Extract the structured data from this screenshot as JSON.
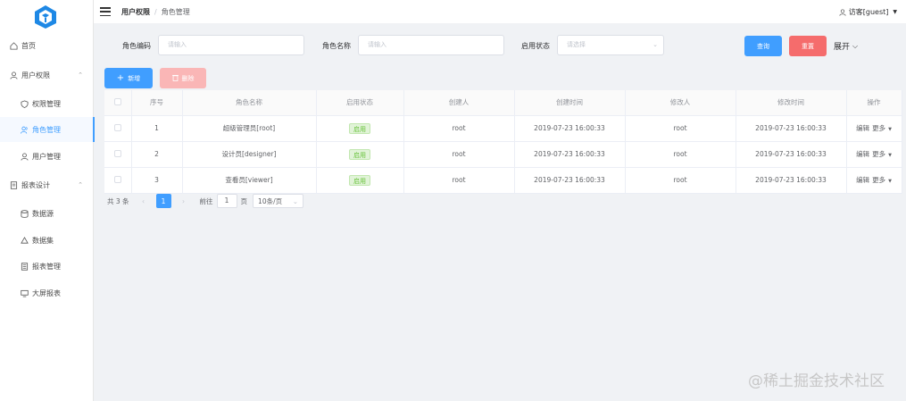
{
  "sidebar": {
    "home": "首页",
    "user_perm": "用户权限",
    "perm_mgmt": "权限管理",
    "role_mgmt": "角色管理",
    "user_mgmt": "用户管理",
    "report_design": "报表设计",
    "datasource": "数据源",
    "dataset": "数据集",
    "report_mgmt": "报表管理",
    "screen_report": "大屏报表"
  },
  "header": {
    "breadcrumb_1": "用户权限",
    "breadcrumb_sep": "/",
    "breadcrumb_2": "角色管理",
    "user": "访客[guest]"
  },
  "search": {
    "role_code_label": "角色编码",
    "role_code_placeholder": "请输入",
    "role_name_label": "角色名称",
    "role_name_placeholder": "请输入",
    "enabled_label": "启用状态",
    "enabled_placeholder": "请选择",
    "query": "查询",
    "reset": "重置",
    "expand": "展开"
  },
  "toolbar": {
    "add": "新增",
    "delete": "删除"
  },
  "table": {
    "headers": [
      "序号",
      "角色名称",
      "启用状态",
      "创建人",
      "创建时间",
      "修改人",
      "修改时间",
      "操作"
    ],
    "rows": [
      {
        "index": "1",
        "name": "超级管理员[root]",
        "status": "启用",
        "creator": "root",
        "created": "2019-07-23 16:00:33",
        "modifier": "root",
        "modified": "2019-07-23 16:00:33",
        "edit": "编辑",
        "more": "更多"
      },
      {
        "index": "2",
        "name": "设计员[designer]",
        "status": "启用",
        "creator": "root",
        "created": "2019-07-23 16:00:33",
        "modifier": "root",
        "modified": "2019-07-23 16:00:33",
        "edit": "编辑",
        "more": "更多"
      },
      {
        "index": "3",
        "name": "查看员[viewer]",
        "status": "启用",
        "creator": "root",
        "created": "2019-07-23 16:00:33",
        "modifier": "root",
        "modified": "2019-07-23 16:00:33",
        "edit": "编辑",
        "more": "更多"
      }
    ]
  },
  "pager": {
    "total": "共 3 条",
    "current": "1",
    "goto": "前往",
    "jump_value": "1",
    "page": "页",
    "size": "10条/页"
  },
  "watermark": "@稀土掘金技术社区",
  "colors": {
    "primary": "#409eff",
    "danger": "#f56c6c",
    "success": "#67c23a"
  }
}
